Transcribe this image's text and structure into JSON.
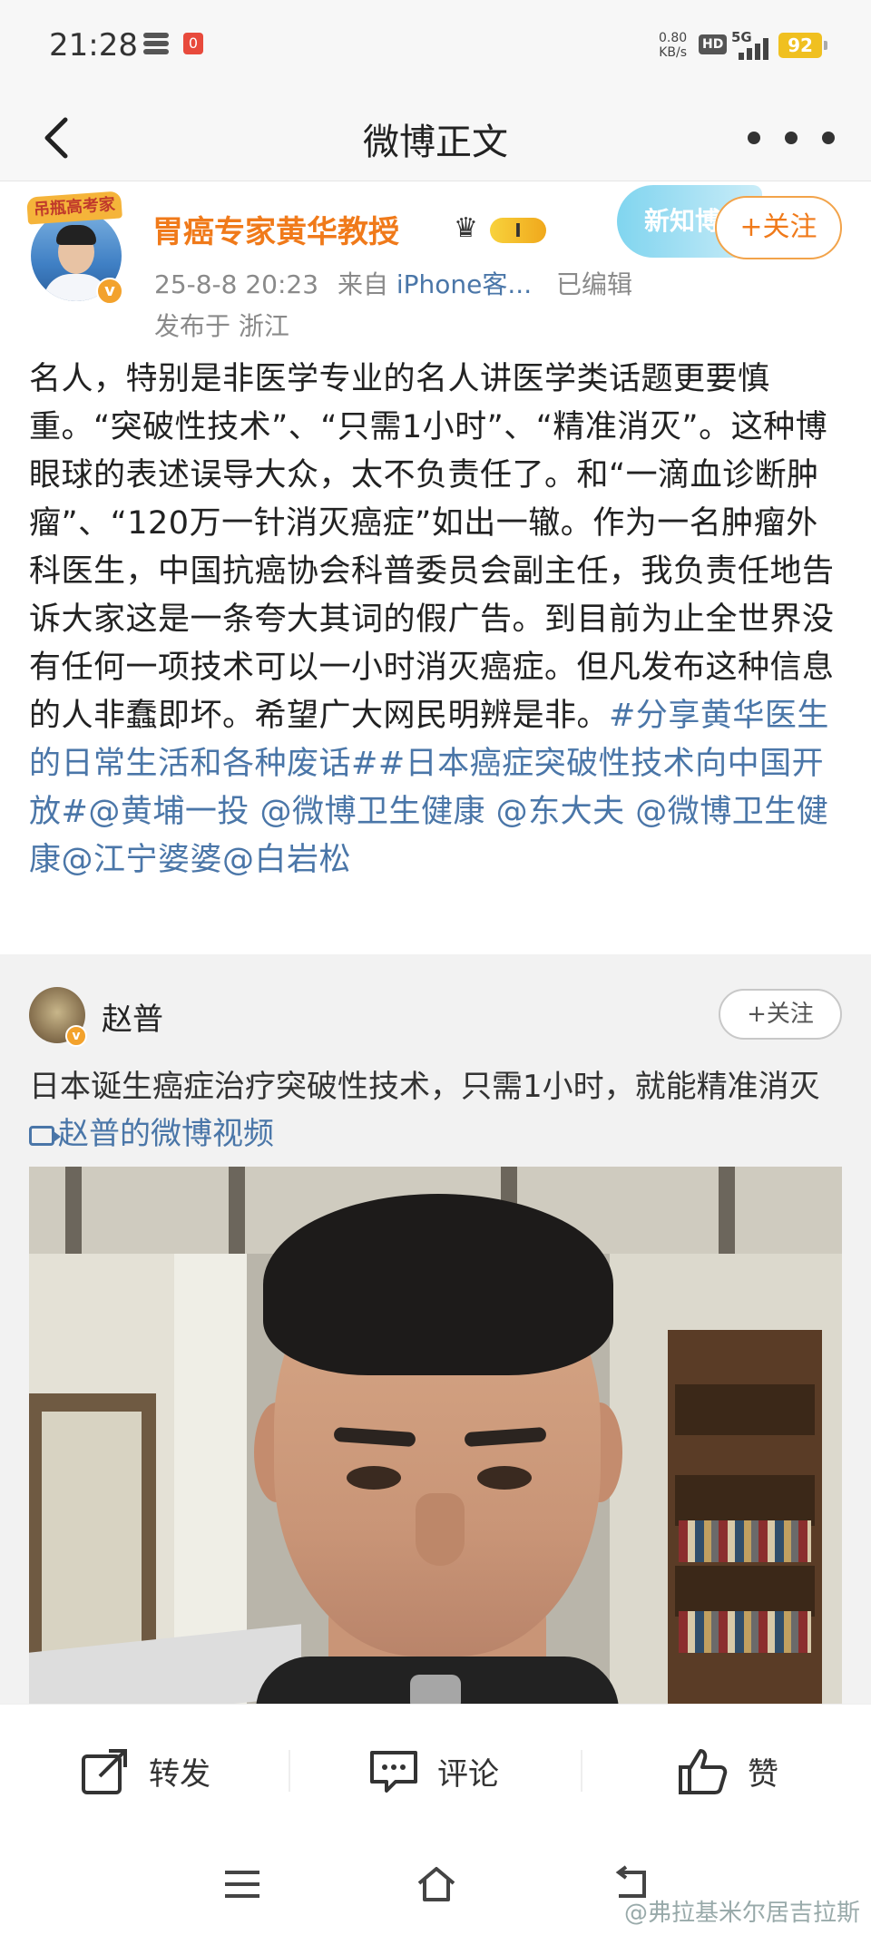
{
  "status_bar": {
    "time": "21:28",
    "notif_count": "0",
    "net_speed_value": "0.80",
    "net_speed_unit": "KB/s",
    "hd_label": "HD",
    "network": "5G",
    "battery": "92"
  },
  "nav": {
    "title": "微博正文"
  },
  "post": {
    "avatar_tag": "吊瓶高考家",
    "author": "胃癌专家黄华教授",
    "level_badge": "I",
    "promo_text": "新知博",
    "follow_label": "+关注",
    "date": "25-8-8 20:23",
    "source_prefix": "来自",
    "source": "iPhone客...",
    "edited": "已编辑",
    "location": "发布于 浙江",
    "text_main": "名人，特别是非医学专业的名人讲医学类话题更要慎重。“突破性技术”、“只需1小时”、“精准消灭”。这种博眼球的表述误导大众，太不负责任了。和“一滴血诊断肿瘤”、“120万一针消灭癌症”如出一辙。作为一名肿瘤外科医生，中国抗癌协会科普委员会副主任，我负责任地告诉大家这是一条夸大其词的假广告。到目前为止全世界没有任何一项技术可以一小时消灭癌症。但凡发布这种信息的人非蠢即坏。希望广大网民明辨是非。",
    "text_tags": "#分享黄华医生的日常生活和各种废话##日本癌症突破性技术向中国开放#@黄埔一投 @微博卫生健康 @东大夫 @微博卫生健康@江宁婆婆@白岩松"
  },
  "repost": {
    "author": "赵普",
    "follow_label": "+关注",
    "text": "日本诞生癌症治疗突破性技术，只需1小时，就能精准消灭",
    "video_link": "赵普的微博视频"
  },
  "actions": {
    "repost_label": "转发",
    "comment_label": "评论",
    "like_label": "赞"
  },
  "watermark": "@弗拉基米尔居吉拉斯",
  "icons": {
    "back": "back-arrow-icon",
    "more": "more-dots-icon",
    "repost": "share-out-icon",
    "comment": "comment-bubble-icon",
    "like": "thumbs-up-icon"
  },
  "colors": {
    "author_orange": "#f07a1a",
    "link_blue": "#4a76a8",
    "battery_yellow": "#f0c020"
  }
}
